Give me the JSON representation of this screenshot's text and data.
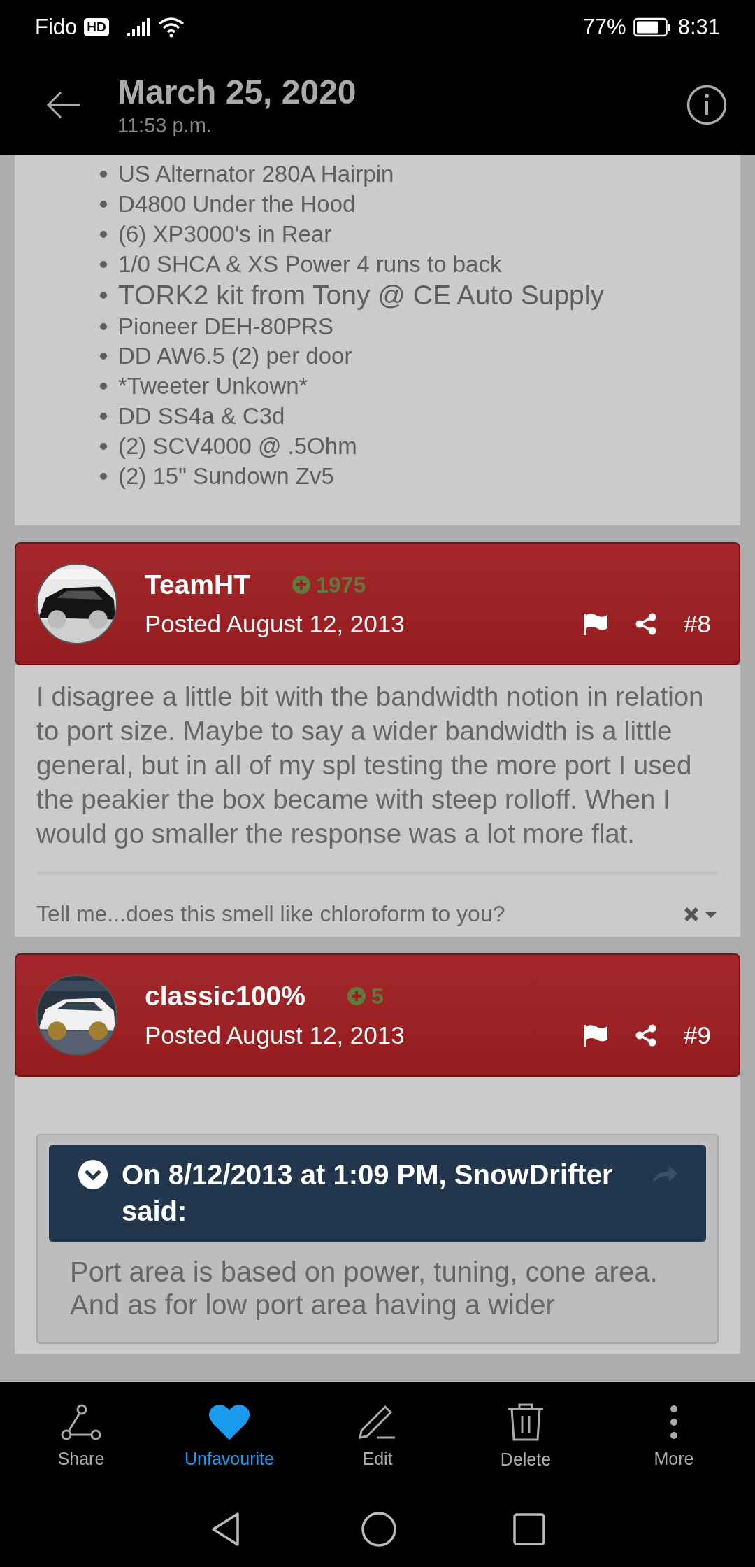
{
  "status_bar": {
    "carrier": "Fido",
    "network_badge": "HD",
    "battery": "77%",
    "time": "8:31"
  },
  "header": {
    "title": "March 25, 2020",
    "subtitle": "11:53 p.m."
  },
  "spec_list": [
    {
      "text": "US Alternator 280A Hairpin",
      "kind": "normal"
    },
    {
      "text": "D4800 Under the Hood",
      "kind": "normal"
    },
    {
      "text": "(6) XP3000's in Rear",
      "kind": "normal"
    },
    {
      "text": "1/0 SHCA & XS Power 4 runs to back",
      "kind": "normal"
    },
    {
      "text": "TORK2 kit from Tony @ CE Auto Supply",
      "kind": "large"
    },
    {
      "text": "Pioneer DEH-80PRS",
      "kind": "normal"
    },
    {
      "text": "DD AW6.5 (2) per door",
      "kind": "normal"
    },
    {
      "text": "*Tweeter Unkown*",
      "kind": "normal"
    },
    {
      "text": "DD SS4a & C3d",
      "kind": "normal"
    },
    {
      "text": "(2) SCV4000 @ .5Ohm",
      "kind": "normal"
    },
    {
      "text": "(2) 15\" Sundown Zv5",
      "kind": "normal"
    }
  ],
  "posts": [
    {
      "author": "TeamHT",
      "reputation": "1975",
      "posted": "Posted August 12, 2013",
      "number": "#8",
      "body": "I disagree a little bit with the bandwidth notion in relation to port size. Maybe to say a wider bandwidth is a little general, but in all of my spl testing the more port I used the peakier the box became with steep rolloff. When I would go smaller the response was a lot more flat.",
      "signature": "Tell me...does this smell like chloroform to you?"
    },
    {
      "author": "classic100%",
      "reputation": "5",
      "posted": "Posted August 12, 2013",
      "number": "#9",
      "quote": {
        "header": "On 8/12/2013 at 1:09 PM, SnowDrifter said:",
        "text": "Port area is based on power, tuning, cone area. And as for low port area having a wider"
      }
    }
  ],
  "actions": [
    {
      "label": "Share",
      "kind": "share",
      "active": false
    },
    {
      "label": "Unfavourite",
      "kind": "favourite",
      "active": true
    },
    {
      "label": "Edit",
      "kind": "edit",
      "active": false
    },
    {
      "label": "Delete",
      "kind": "delete",
      "active": false
    },
    {
      "label": "More",
      "kind": "more",
      "active": false
    }
  ]
}
